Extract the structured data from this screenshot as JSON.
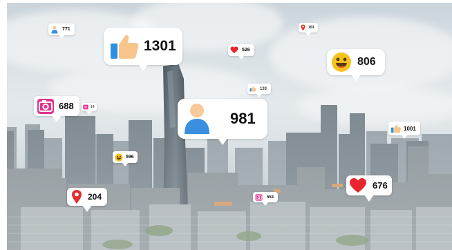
{
  "notifications": {
    "like_large": {
      "icon": "thumbs-up-icon",
      "count": "1301"
    },
    "follower_large": {
      "icon": "person-icon",
      "count": "981"
    },
    "smile_large": {
      "icon": "smiley-face-icon",
      "count": "806"
    },
    "camera_medium": {
      "icon": "camera-icon",
      "count": "688"
    },
    "heart_medium": {
      "icon": "heart-icon",
      "count": "676"
    },
    "pin_medium": {
      "icon": "location-pin-icon",
      "count": "204"
    },
    "like_right": {
      "icon": "thumbs-up-icon",
      "count": "1001"
    },
    "person_top": {
      "icon": "person-icon",
      "count": "771"
    },
    "heart_top": {
      "icon": "heart-icon",
      "count": "526"
    },
    "pin_top": {
      "icon": "location-pin-icon",
      "count": "153"
    },
    "like_small": {
      "icon": "thumbs-up-icon",
      "count": "133"
    },
    "smile_small": {
      "icon": "smiley-face-icon",
      "count": "596"
    },
    "camera_small": {
      "icon": "camera-icon",
      "count": "553"
    },
    "camera_tiny": {
      "icon": "camera-icon",
      "count": "14"
    }
  },
  "colors": {
    "like_blue": "#2e8fe0",
    "like_skin": "#f7c58c",
    "camera_pink": "#e0348c",
    "heart_red": "#e8252e",
    "pin_red": "#e3312d",
    "smile_yellow": "#f6c21c",
    "person_blue": "#3a8fe0",
    "person_skin": "#f8c99a"
  }
}
